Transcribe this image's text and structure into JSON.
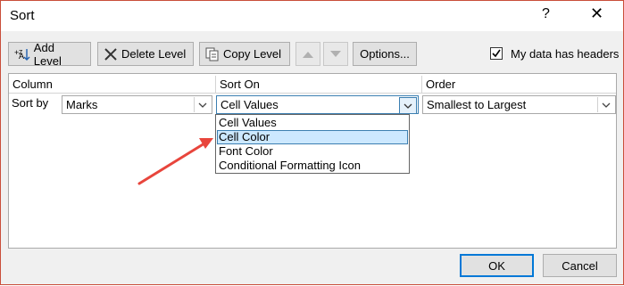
{
  "title": "Sort",
  "title_buttons": {
    "help": "?",
    "close": "✕"
  },
  "toolbar": {
    "add_level": "Add Level",
    "delete_level": "Delete Level",
    "copy_level": "Copy Level",
    "options": "Options...",
    "headers_checkbox_label": "My data has headers",
    "headers_checked": true
  },
  "columns": {
    "column": "Column",
    "sort_on": "Sort On",
    "order": "Order"
  },
  "row": {
    "label": "Sort by",
    "column_value": "Marks",
    "sort_on_value": "Cell Values",
    "order_value": "Smallest to Largest"
  },
  "dropdown": {
    "options": [
      "Cell Values",
      "Cell Color",
      "Font Color",
      "Conditional Formatting Icon"
    ],
    "highlighted": "Cell Color"
  },
  "footer": {
    "ok": "OK",
    "cancel": "Cancel"
  },
  "colors": {
    "annotation_arrow": "#e8453c",
    "selection": "#cce8ff",
    "focus_border": "#0078d7"
  }
}
